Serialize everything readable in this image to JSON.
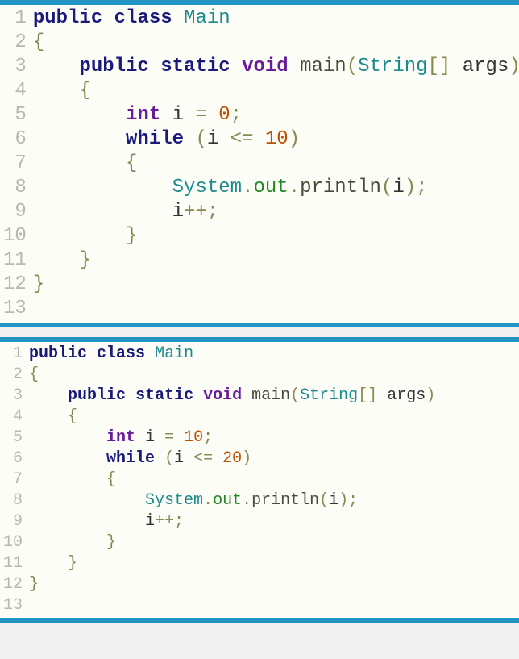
{
  "colors": {
    "border": "#2196c4",
    "background": "#fdfdf8",
    "lineNumber": "#b8b8b0",
    "keyword": "#1a1a7a",
    "className": "#1a8a8a",
    "type": "#6a1b9a",
    "number": "#c05000",
    "field": "#228822",
    "punctuation": "#888850"
  },
  "blocks": [
    {
      "fontSize": 24,
      "lineCount": 13,
      "lines": [
        {
          "indent": 0,
          "tokens": [
            {
              "t": "kw",
              "v": "public"
            },
            {
              "t": "sp"
            },
            {
              "t": "kw",
              "v": "class"
            },
            {
              "t": "sp"
            },
            {
              "t": "cls",
              "v": "Main"
            }
          ]
        },
        {
          "indent": 0,
          "tokens": [
            {
              "t": "brace",
              "v": "{"
            }
          ]
        },
        {
          "indent": 1,
          "tokens": [
            {
              "t": "kw",
              "v": "public"
            },
            {
              "t": "sp"
            },
            {
              "t": "kw",
              "v": "static"
            },
            {
              "t": "sp"
            },
            {
              "t": "type",
              "v": "void"
            },
            {
              "t": "sp"
            },
            {
              "t": "method",
              "v": "main"
            },
            {
              "t": "paren",
              "v": "("
            },
            {
              "t": "cls",
              "v": "String"
            },
            {
              "t": "bracket",
              "v": "[]"
            },
            {
              "t": "sp"
            },
            {
              "t": "plain",
              "v": "args"
            },
            {
              "t": "paren",
              "v": ")"
            }
          ]
        },
        {
          "indent": 1,
          "tokens": [
            {
              "t": "brace",
              "v": "{"
            }
          ]
        },
        {
          "indent": 2,
          "tokens": [
            {
              "t": "type",
              "v": "int"
            },
            {
              "t": "sp"
            },
            {
              "t": "plain",
              "v": "i"
            },
            {
              "t": "sp"
            },
            {
              "t": "op",
              "v": "="
            },
            {
              "t": "sp"
            },
            {
              "t": "num",
              "v": "0"
            },
            {
              "t": "semi",
              "v": ";"
            }
          ]
        },
        {
          "indent": 2,
          "tokens": [
            {
              "t": "kw",
              "v": "while"
            },
            {
              "t": "sp"
            },
            {
              "t": "paren",
              "v": "("
            },
            {
              "t": "plain",
              "v": "i"
            },
            {
              "t": "sp"
            },
            {
              "t": "op",
              "v": "<="
            },
            {
              "t": "sp"
            },
            {
              "t": "num",
              "v": "10"
            },
            {
              "t": "paren",
              "v": ")"
            }
          ]
        },
        {
          "indent": 2,
          "tokens": [
            {
              "t": "brace",
              "v": "{"
            }
          ]
        },
        {
          "indent": 3,
          "tokens": [
            {
              "t": "cls",
              "v": "System"
            },
            {
              "t": "punct",
              "v": "."
            },
            {
              "t": "field",
              "v": "out"
            },
            {
              "t": "punct",
              "v": "."
            },
            {
              "t": "method",
              "v": "println"
            },
            {
              "t": "paren",
              "v": "("
            },
            {
              "t": "plain",
              "v": "i"
            },
            {
              "t": "paren",
              "v": ")"
            },
            {
              "t": "semi",
              "v": ";"
            }
          ]
        },
        {
          "indent": 3,
          "tokens": [
            {
              "t": "plain",
              "v": "i"
            },
            {
              "t": "op",
              "v": "++"
            },
            {
              "t": "semi",
              "v": ";"
            }
          ]
        },
        {
          "indent": 2,
          "tokens": [
            {
              "t": "brace",
              "v": "}"
            }
          ]
        },
        {
          "indent": 1,
          "tokens": [
            {
              "t": "brace",
              "v": "}"
            }
          ]
        },
        {
          "indent": 0,
          "tokens": [
            {
              "t": "brace",
              "v": "}"
            }
          ]
        },
        {
          "indent": 0,
          "tokens": []
        }
      ]
    },
    {
      "fontSize": 20,
      "lineCount": 13,
      "lines": [
        {
          "indent": 0,
          "tokens": [
            {
              "t": "kw",
              "v": "public"
            },
            {
              "t": "sp"
            },
            {
              "t": "kw",
              "v": "class"
            },
            {
              "t": "sp"
            },
            {
              "t": "cls",
              "v": "Main"
            }
          ]
        },
        {
          "indent": 0,
          "tokens": [
            {
              "t": "brace",
              "v": "{"
            }
          ]
        },
        {
          "indent": 1,
          "tokens": [
            {
              "t": "kw",
              "v": "public"
            },
            {
              "t": "sp"
            },
            {
              "t": "kw",
              "v": "static"
            },
            {
              "t": "sp"
            },
            {
              "t": "type",
              "v": "void"
            },
            {
              "t": "sp"
            },
            {
              "t": "method",
              "v": "main"
            },
            {
              "t": "paren",
              "v": "("
            },
            {
              "t": "cls",
              "v": "String"
            },
            {
              "t": "bracket",
              "v": "[]"
            },
            {
              "t": "sp"
            },
            {
              "t": "plain",
              "v": "args"
            },
            {
              "t": "paren",
              "v": ")"
            }
          ]
        },
        {
          "indent": 1,
          "tokens": [
            {
              "t": "brace",
              "v": "{"
            }
          ]
        },
        {
          "indent": 2,
          "tokens": [
            {
              "t": "type",
              "v": "int"
            },
            {
              "t": "sp"
            },
            {
              "t": "plain",
              "v": "i"
            },
            {
              "t": "sp"
            },
            {
              "t": "op",
              "v": "="
            },
            {
              "t": "sp"
            },
            {
              "t": "num",
              "v": "10"
            },
            {
              "t": "semi",
              "v": ";"
            }
          ]
        },
        {
          "indent": 2,
          "tokens": [
            {
              "t": "kw",
              "v": "while"
            },
            {
              "t": "sp"
            },
            {
              "t": "paren",
              "v": "("
            },
            {
              "t": "plain",
              "v": "i"
            },
            {
              "t": "sp"
            },
            {
              "t": "op",
              "v": "<="
            },
            {
              "t": "sp"
            },
            {
              "t": "num",
              "v": "20"
            },
            {
              "t": "paren",
              "v": ")"
            }
          ]
        },
        {
          "indent": 2,
          "tokens": [
            {
              "t": "brace",
              "v": "{"
            }
          ]
        },
        {
          "indent": 3,
          "tokens": [
            {
              "t": "cls",
              "v": "System"
            },
            {
              "t": "punct",
              "v": "."
            },
            {
              "t": "field",
              "v": "out"
            },
            {
              "t": "punct",
              "v": "."
            },
            {
              "t": "method",
              "v": "println"
            },
            {
              "t": "paren",
              "v": "("
            },
            {
              "t": "plain",
              "v": "i"
            },
            {
              "t": "paren",
              "v": ")"
            },
            {
              "t": "semi",
              "v": ";"
            }
          ]
        },
        {
          "indent": 3,
          "tokens": [
            {
              "t": "plain",
              "v": "i"
            },
            {
              "t": "op",
              "v": "++"
            },
            {
              "t": "semi",
              "v": ";"
            }
          ]
        },
        {
          "indent": 2,
          "tokens": [
            {
              "t": "brace",
              "v": "}"
            }
          ]
        },
        {
          "indent": 1,
          "tokens": [
            {
              "t": "brace",
              "v": "}"
            }
          ]
        },
        {
          "indent": 0,
          "tokens": [
            {
              "t": "brace",
              "v": "}"
            }
          ]
        },
        {
          "indent": 0,
          "tokens": []
        }
      ]
    }
  ]
}
